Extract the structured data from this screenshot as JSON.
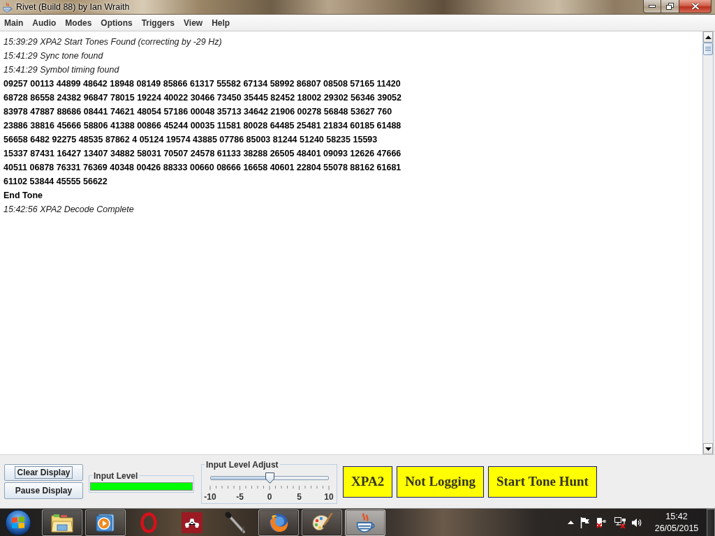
{
  "window": {
    "title": "Rivet (Build 88) by Ian Wraith"
  },
  "menu": [
    "Main",
    "Audio",
    "Modes",
    "Options",
    "Triggers",
    "View",
    "Help"
  ],
  "log": [
    {
      "kind": "status",
      "text": "15:39:29 XPA2 Start Tones Found (correcting by -29 Hz)"
    },
    {
      "kind": "status",
      "text": "15:41:29 Sync tone found"
    },
    {
      "kind": "status",
      "text": "15:41:29 Symbol timing found"
    },
    {
      "kind": "data",
      "text": "09257 00113 44899 48642 18948 08149 85866 61317 55582 67134 58992 86807 08508 57165 11420"
    },
    {
      "kind": "data",
      "text": "68728 86558 24382 96847 78015 19224 40022 30466 73450 35445 82452 18002 29302 56346 39052"
    },
    {
      "kind": "data",
      "text": "83978 47887 88686 08441 74621 48054 57186 00048 35713 34642 21906 00278 56848 53627 760"
    },
    {
      "kind": "data",
      "text": "23886 38816 45666 58806 41388 00866 45244 00035 11581 80028 64485 25481 21834 60185 61488"
    },
    {
      "kind": "data",
      "text": "56658 6482 92275 48535 87862 4 05124 19574 43885 07786 85003 81244 51240 58235 15593"
    },
    {
      "kind": "data",
      "text": "15337 87431 16427 13407 34882 58031 70507 24578 61133 38288 26505 48401 09093 12626 47666"
    },
    {
      "kind": "data",
      "text": "40511 06878 76331 76369 40348 00426 88333 00660 08666 16658 40601 22804 55078 88162 61681"
    },
    {
      "kind": "data",
      "text": "61102 53844 45555 56622"
    },
    {
      "kind": "data",
      "text": "End Tone"
    },
    {
      "kind": "status",
      "text": "15:42:56 XPA2 Decode Complete"
    }
  ],
  "display_buttons": [
    {
      "label": "Clear Display",
      "focused": true
    },
    {
      "label": "Pause Display",
      "focused": false
    }
  ],
  "input_level": {
    "title": "Input Level",
    "level": 1
  },
  "input_level_adjust": {
    "title": "Input Level Adjust",
    "level": 0.5,
    "scale_labels": [
      "-10",
      "-5",
      "0",
      "5",
      "10"
    ]
  },
  "status_buttons": [
    "XPA2",
    "Not Logging",
    "Start Tone Hunt"
  ],
  "taskbar": {
    "apps": [
      {
        "kind": "folder",
        "running": true,
        "selected": false
      },
      {
        "kind": "media",
        "running": true,
        "selected": false
      },
      {
        "kind": "ring",
        "running": false,
        "selected": false
      },
      {
        "kind": "tile",
        "running": false,
        "selected": false
      },
      {
        "kind": "microphone",
        "running": false,
        "selected": false
      },
      {
        "kind": "globe",
        "running": true,
        "selected": false
      },
      {
        "kind": "palette",
        "running": true,
        "selected": false
      },
      {
        "kind": "cup",
        "running": true,
        "selected": true
      }
    ],
    "clock": {
      "time": "15:42",
      "date": "26/05/2015"
    }
  }
}
